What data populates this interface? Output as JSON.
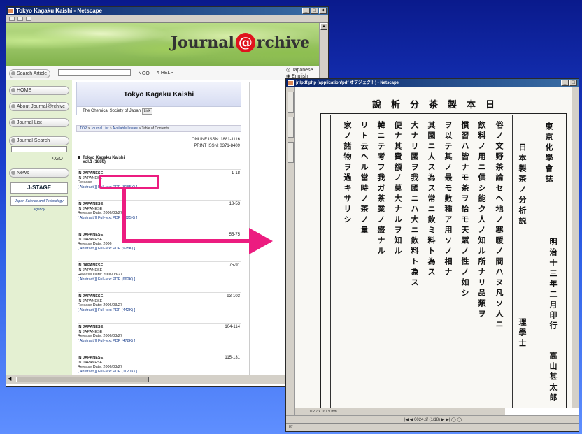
{
  "left_window": {
    "title": "Tokyo Kagaku Kaishi - Netscape",
    "controls": [
      "_",
      "□",
      "×"
    ],
    "banner": {
      "brand_a": "Journal",
      "brand_at": "@",
      "brand_b": "rchive"
    },
    "search_row": {
      "button": "Search Article",
      "go": "GO",
      "help": "# HELP",
      "lang_ja": "Japanese",
      "lang_en": "English"
    },
    "sidebar": {
      "items": [
        "HOME",
        "About Journal@rchive",
        "Journal List",
        "Journal Search",
        "News"
      ],
      "search_go": "GO",
      "logo1": "J-STAGE",
      "logo2": "Japan Science and Technology Agency"
    },
    "journal": {
      "title": "Tokyo Kagaku Kaishi",
      "society": "The Chemical Society of Japan",
      "link_label": "Link",
      "breadcrumb": [
        "TOP",
        "Journal List",
        "Available Issues",
        "Table of Contents"
      ],
      "breadcrumb_sep": " > ",
      "online_issn": "ONLINE ISSN: 1881-1116",
      "print_issn": "PRINT ISSN: 0371-8409",
      "volume_title": "Tokyo Kagaku Kaishi",
      "volume": "Vol.1 (1880)"
    },
    "articles": [
      {
        "title": "IN JAPANESE",
        "subtitle": "IN JAPANESE",
        "release": "Release",
        "pages": "1-18",
        "abstract": "[ Abstract ]",
        "pdf": "[ Full-text PDF (8185K) ]"
      },
      {
        "title": "IN JAPANESE",
        "subtitle": "IN JAPANESE",
        "release": "Release Date: 2006/03/27",
        "pages": "18-53",
        "abstract": "[ Abstract ]",
        "pdf": "[ Full-text PDF (1325K) ]"
      },
      {
        "title": "IN JAPANESE",
        "subtitle": "IN JAPANESE",
        "release": "Release Date: 2006",
        "pages": "55-75",
        "abstract": "[ Abstract ]",
        "pdf": "[ Full-text PDF (925K) ]"
      },
      {
        "title": "IN JAPANESE",
        "subtitle": "IN JAPANESE",
        "release": "Release Date: 2006/03/27",
        "pages": "75-91",
        "abstract": "[ Abstract ]",
        "pdf": "[ Full-text PDF (662K) ]"
      },
      {
        "title": "IN JAPANESE",
        "subtitle": "IN JAPANESE",
        "release": "Release Date: 2006/03/27",
        "pages": "93-103",
        "abstract": "[ Abstract ]",
        "pdf": "[ Full-text PDF (442K) ]"
      },
      {
        "title": "IN JAPANESE",
        "subtitle": "IN JAPANESE",
        "release": "Release Date: 2006/03/27",
        "pages": "104-114",
        "abstract": "[ Abstract ]",
        "pdf": "[ Full-text PDF (478K) ]"
      },
      {
        "title": "IN JAPANESE",
        "subtitle": "IN JAPANESE",
        "release": "Release Date: 2006/03/27",
        "pages": "115-131",
        "abstract": "[ Abstract ]",
        "pdf": "[ Full-text PDF (1120K) ]"
      }
    ]
  },
  "right_window": {
    "title": "jnlpdf.php (application/pdf オブジェクト) - Netscape",
    "controls": [
      "_",
      "□"
    ],
    "doc_header": "說析分茶製本日",
    "columns": [
      "東京化學會誌",
      "日本製茶ノ分析説",
      "明治十三年二月印行",
      "理學士",
      "高山甚太郎",
      "俗ノ文野茶論セヘ地ノ寒暖ノ間ハヌ凡ソ人ニ",
      "飲料ノ用ニ供シ能ク人ノ知ル所ナリ品類ヲ",
      "慣習ハ皆ナモ茶ヲ恰モ天賦ノ性ノ如シ",
      "ヲ以テ其ノ最モ數種ア用ソノ相ナ",
      "其國ニ人ス為ス常ニ飲ミ料ト為ス",
      "大ナリ國ヲ我國ニハ大ニ飲料ト為ス",
      "便ナ其費額ノ莫大ナルヲ知ル",
      "韓ニテ考フ我ガ茶業ノ盛ナル",
      "リト云ヘル當時ノ茶ノ量",
      "家ノ諸物ヲ過キサリシ"
    ],
    "zoom_readout": "112.7 x 167.9 mm",
    "page_nav": "0024.tif (1/18)",
    "status_text": "87"
  }
}
